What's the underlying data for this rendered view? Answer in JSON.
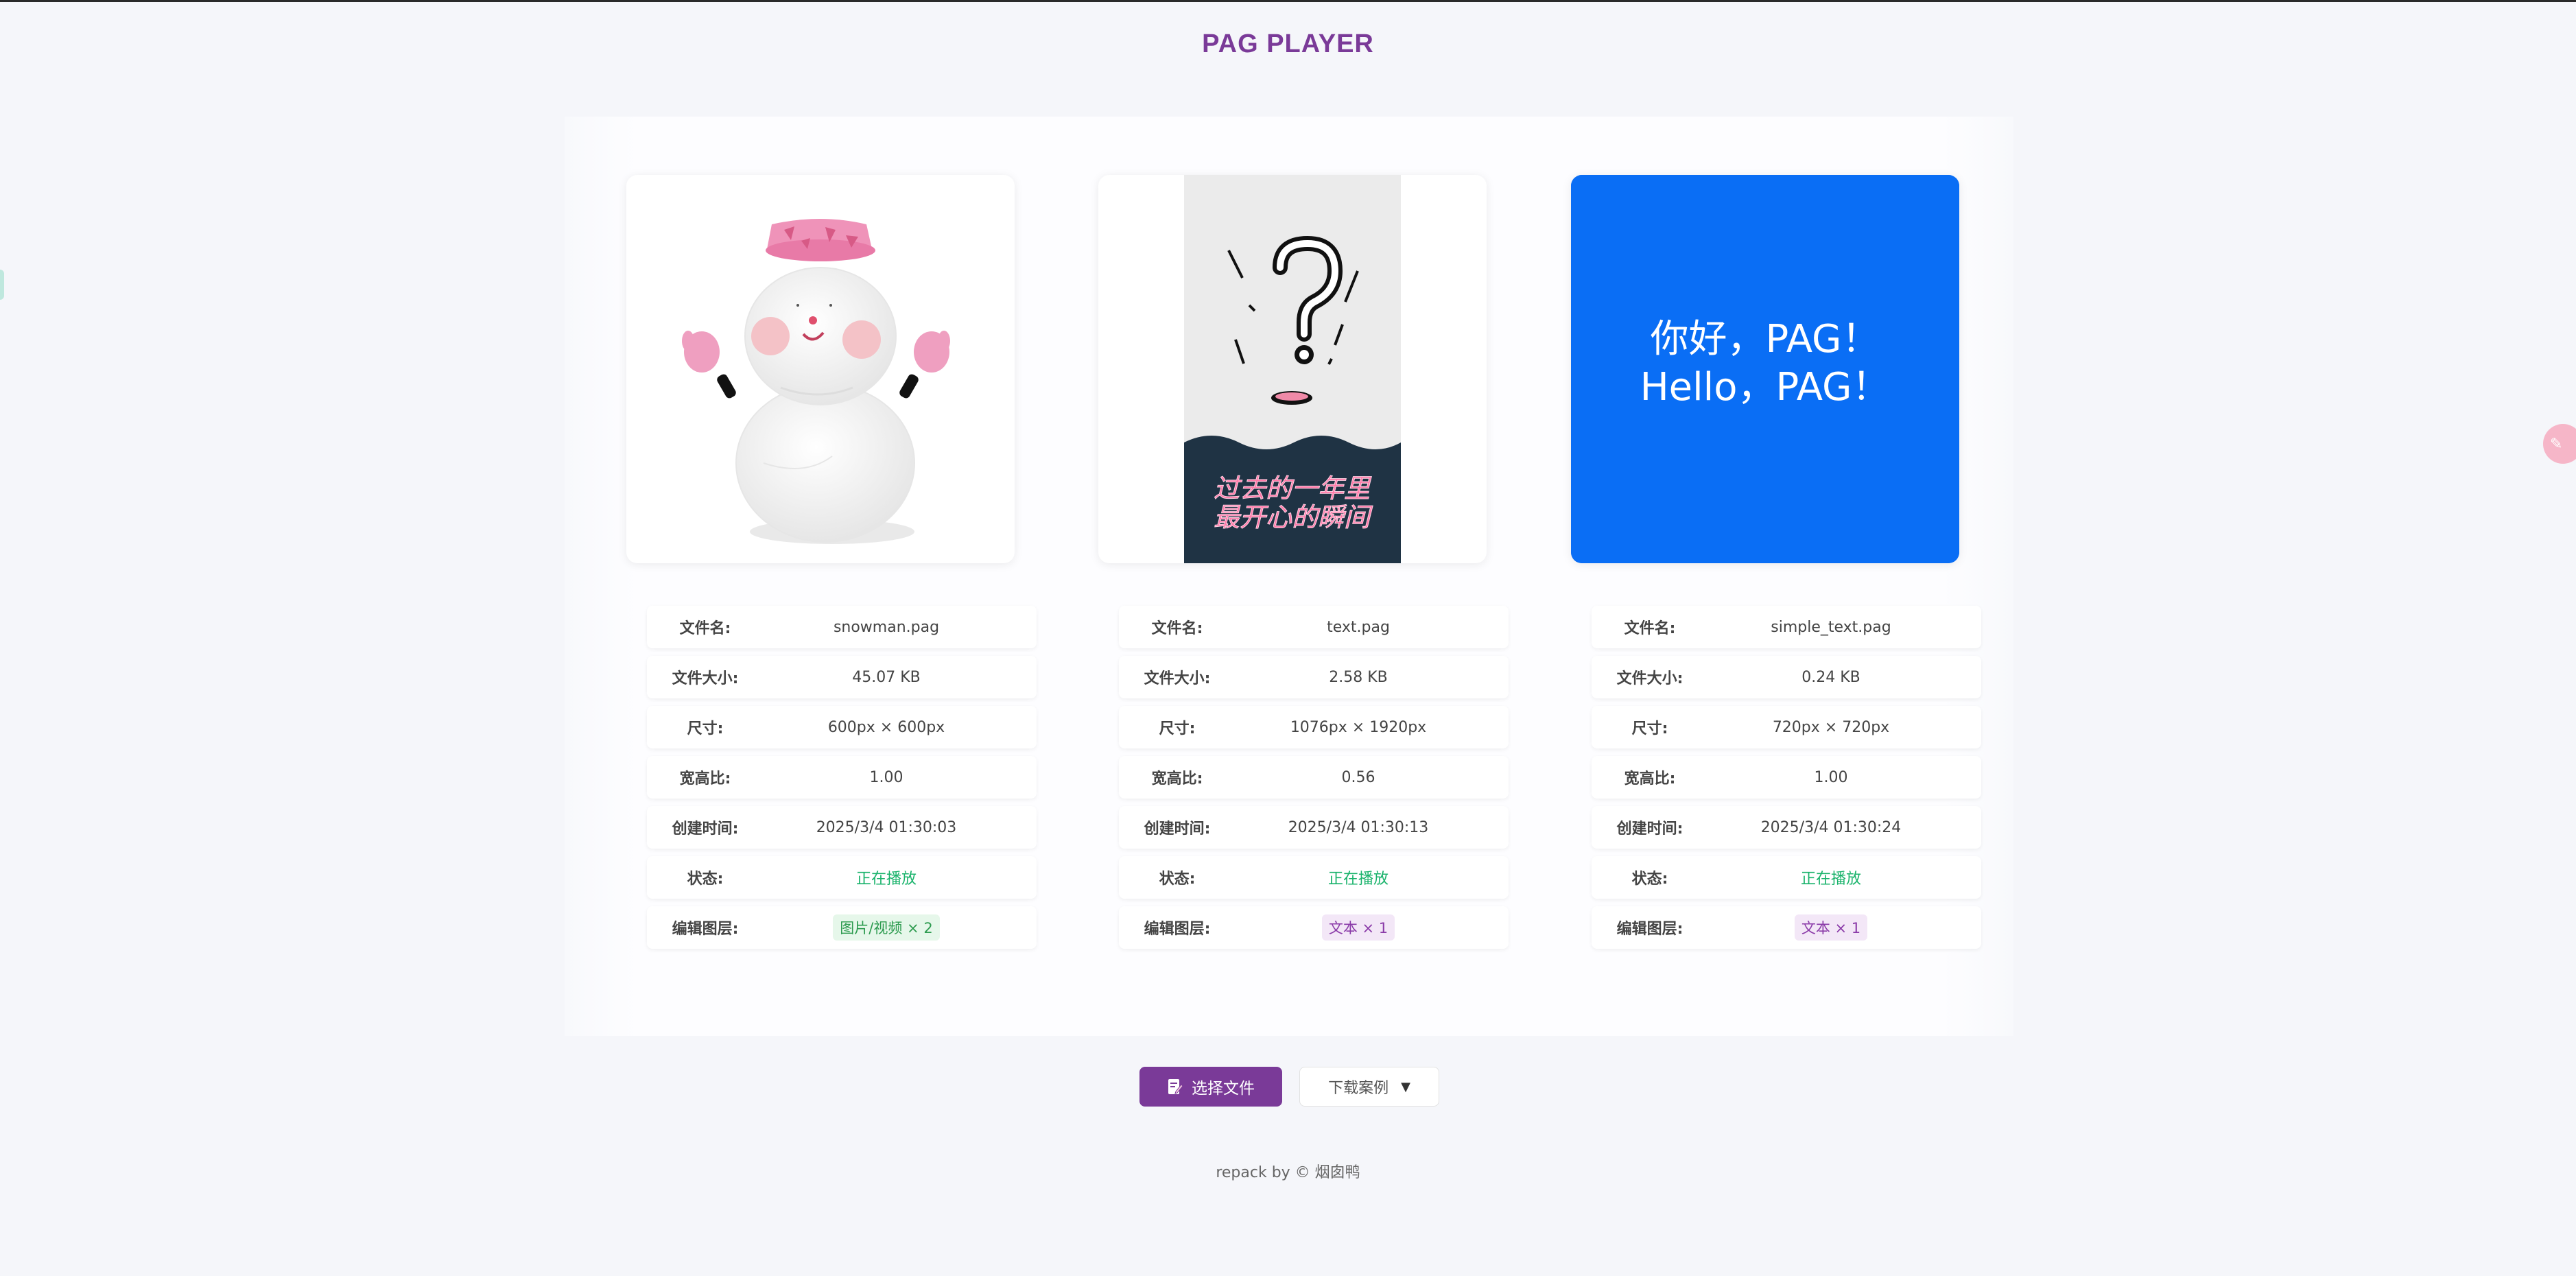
{
  "header": {
    "title": "PAG PLAYER"
  },
  "labels": {
    "file_name": "文件名:",
    "file_size": "文件大小:",
    "dimensions": "尺寸:",
    "aspect_ratio": "宽高比:",
    "created": "创建时间:",
    "status": "状态:",
    "editable_layers": "编辑图层:"
  },
  "cards": [
    {
      "file_name": "snowman.pag",
      "file_size": "45.07 KB",
      "dimensions": "600px × 600px",
      "aspect_ratio": "1.00",
      "created": "2025/3/4 01:30:03",
      "status": "正在播放",
      "layers": "图片/视频 × 2"
    },
    {
      "file_name": "text.pag",
      "file_size": "2.58 KB",
      "dimensions": "1076px × 1920px",
      "aspect_ratio": "0.56",
      "created": "2025/3/4 01:30:13",
      "status": "正在播放",
      "layers": "文本 × 1",
      "preview_text": [
        "过去的一年里",
        "最开心的瞬间"
      ]
    },
    {
      "file_name": "simple_text.pag",
      "file_size": "0.24 KB",
      "dimensions": "720px × 720px",
      "aspect_ratio": "1.00",
      "created": "2025/3/4 01:30:24",
      "status": "正在播放",
      "layers": "文本 × 1",
      "preview_text": [
        "你好，PAG！",
        "Hello，PAG！"
      ]
    }
  ],
  "actions": {
    "select_file": "选择文件",
    "download_examples": "下载案例",
    "dropdown_arrow": "▼"
  },
  "footer": {
    "text": "repack by © 烟囱鸭"
  },
  "colors": {
    "accent": "#7a3a98",
    "playing": "#19b36b",
    "blue_preview": "#0a6ef5",
    "dark_band": "#1f3344"
  }
}
